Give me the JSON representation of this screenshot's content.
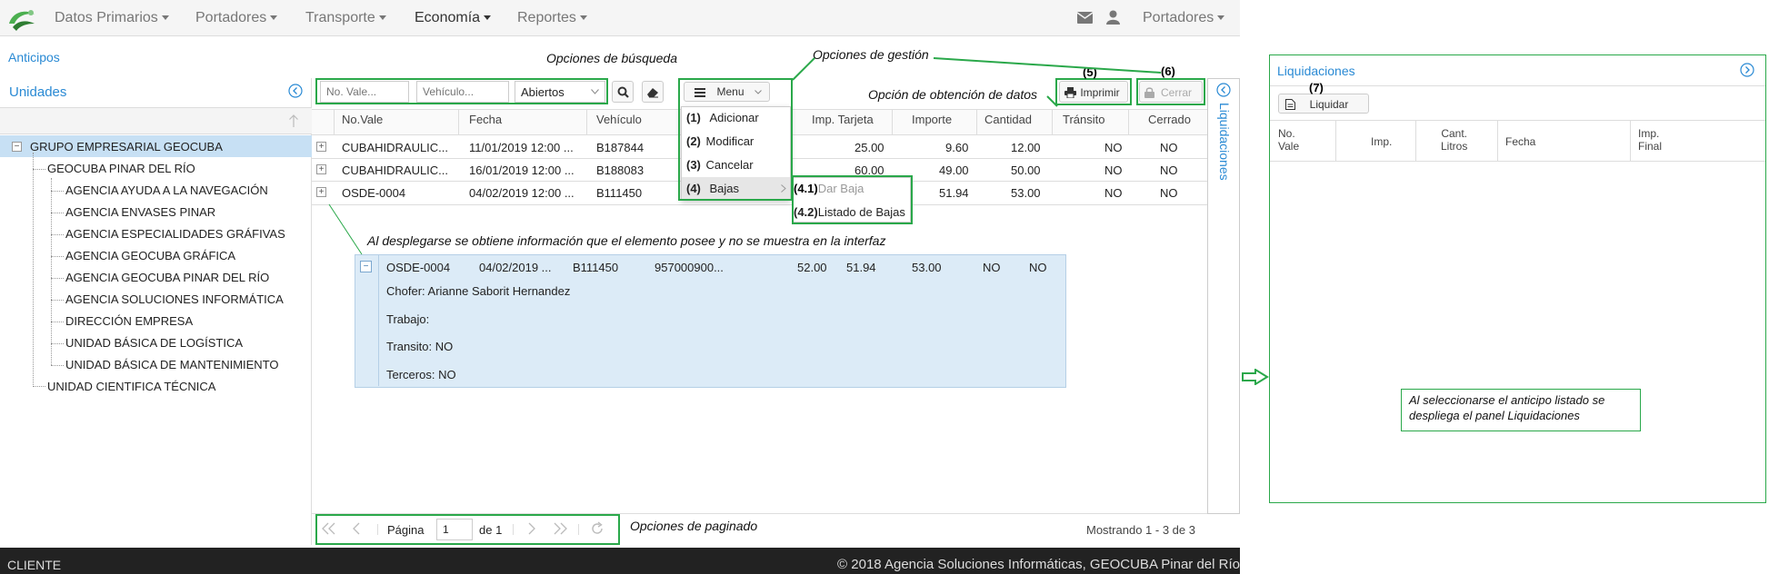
{
  "nav": {
    "items": [
      "Datos Primarios",
      "Portadores",
      "Transporte",
      "Economía",
      "Reportes"
    ],
    "active": "Economía",
    "user_menu": "Portadores"
  },
  "breadcrumb": "Anticipos",
  "left_panel": {
    "title": "Unidades",
    "tree": [
      {
        "label": "GRUPO EMPRESARIAL GEOCUBA",
        "level": 0,
        "selected": true
      },
      {
        "label": "GEOCUBA PINAR DEL RÍO",
        "level": 1
      },
      {
        "label": "AGENCIA AYUDA A LA NAVEGACIÓN",
        "level": 2
      },
      {
        "label": "AGENCIA ENVASES PINAR",
        "level": 2
      },
      {
        "label": "AGENCIA ESPECIALIDADES GRÁFIVAS",
        "level": 2
      },
      {
        "label": "AGENCIA GEOCUBA GRÁFICA",
        "level": 2
      },
      {
        "label": "AGENCIA GEOCUBA PINAR DEL RÍO",
        "level": 2
      },
      {
        "label": "AGENCIA SOLUCIONES INFORMÁTICA",
        "level": 2
      },
      {
        "label": "DIRECCIÓN EMPRESA",
        "level": 2
      },
      {
        "label": "UNIDAD BÁSICA DE LOGÍSTICA",
        "level": 2
      },
      {
        "label": "UNIDAD BÁSICA DE MANTENIMIENTO",
        "level": 2
      },
      {
        "label": "UNIDAD CIENTIFICA TÉCNICA",
        "level": 1
      }
    ]
  },
  "toolbar": {
    "vale_placeholder": "No. Vale...",
    "vehiculo_placeholder": "Vehículo...",
    "filter_value": "Abiertos",
    "menu_label": "Menu",
    "print_label": "Imprimir",
    "close_label": "Cerrar"
  },
  "menu": {
    "items": [
      {
        "num": "(1)",
        "label": "Adicionar"
      },
      {
        "num": "(2)",
        "label": "Modificar"
      },
      {
        "num": "(3)",
        "label": "Cancelar"
      },
      {
        "num": "(4)",
        "label": "Bajas"
      }
    ],
    "submenu": [
      {
        "num": "(4.1)",
        "label": "Dar Baja"
      },
      {
        "num": "(4.2)",
        "label": "Listado de Bajas"
      }
    ]
  },
  "grid": {
    "columns": [
      "No.Vale",
      "Fecha",
      "Vehículo",
      "Imp. Tarjeta",
      "Importe",
      "Cantidad",
      "Tránsito",
      "Cerrado"
    ],
    "rows": [
      {
        "vale": "CUBAHIDRAULIC...",
        "fecha": "11/01/2019 12:00 ...",
        "vehiculo": "B187844",
        "imp_tarjeta": "25.00",
        "importe": "9.60",
        "cantidad": "12.00",
        "transito": "NO",
        "cerrado": "NO"
      },
      {
        "vale": "CUBAHIDRAULIC...",
        "fecha": "16/01/2019 12:00 ...",
        "vehiculo": "B188083",
        "imp_tarjeta": "60.00",
        "importe": "49.00",
        "cantidad": "50.00",
        "transito": "NO",
        "cerrado": "NO"
      },
      {
        "vale": "OSDE-0004",
        "fecha": "04/02/2019 12:00 ...",
        "vehiculo": "B111450",
        "imp_tarjeta": "",
        "importe": "51.94",
        "cantidad": "53.00",
        "transito": "NO",
        "cerrado": "NO"
      }
    ]
  },
  "detail": {
    "vale": "OSDE-0004",
    "fecha": "04/02/2019 ...",
    "vehiculo": "B111450",
    "tarjeta": "957000900...",
    "imp_tarjeta": "52.00",
    "importe": "51.94",
    "cantidad": "53.00",
    "transito": "NO",
    "cerrado": "NO",
    "chofer": "Chofer: Arianne Saborit Hernandez",
    "trabajo": "Trabajo:",
    "transito_line": "Transito: NO",
    "terceros_line": "Terceros: NO"
  },
  "pager": {
    "page_label": "Página",
    "page_value": "1",
    "of_label": "de 1",
    "status": "Mostrando 1 - 3 de 3"
  },
  "side_tab": "Liquidaciones",
  "liquidaciones": {
    "title": "Liquidaciones",
    "button": "Liquidar",
    "columns": [
      "No.\nVale",
      "Imp.",
      "Cant.\nLitros",
      "Fecha",
      "Imp.\nFinal"
    ]
  },
  "annotations": {
    "busqueda": "Opciones de búsqueda",
    "gestion": "Opciones de gestión",
    "obtencion": "Opción de obtención de datos",
    "detalle": "Al desplegarse se obtiene información que el elemento posee y no se muestra en la interfaz",
    "paginado": "Opciones de paginado",
    "liquid_note": "Al seleccionarse el anticipo listado se despliega el panel Liquidaciones",
    "n5": "(5)",
    "n6": "(6)",
    "n7": "(7)"
  },
  "footer": {
    "left": "CLIENTE",
    "right": "© 2018 Agencia Soluciones Informáticas, GEOCUBA Pinar del Río"
  },
  "colors": {
    "annotation_border": "#2aa84a",
    "link": "#2a8ad4",
    "selected_row": "#c7e0f4",
    "detail_bg": "#dcebf7",
    "footer_bg": "#222222"
  }
}
